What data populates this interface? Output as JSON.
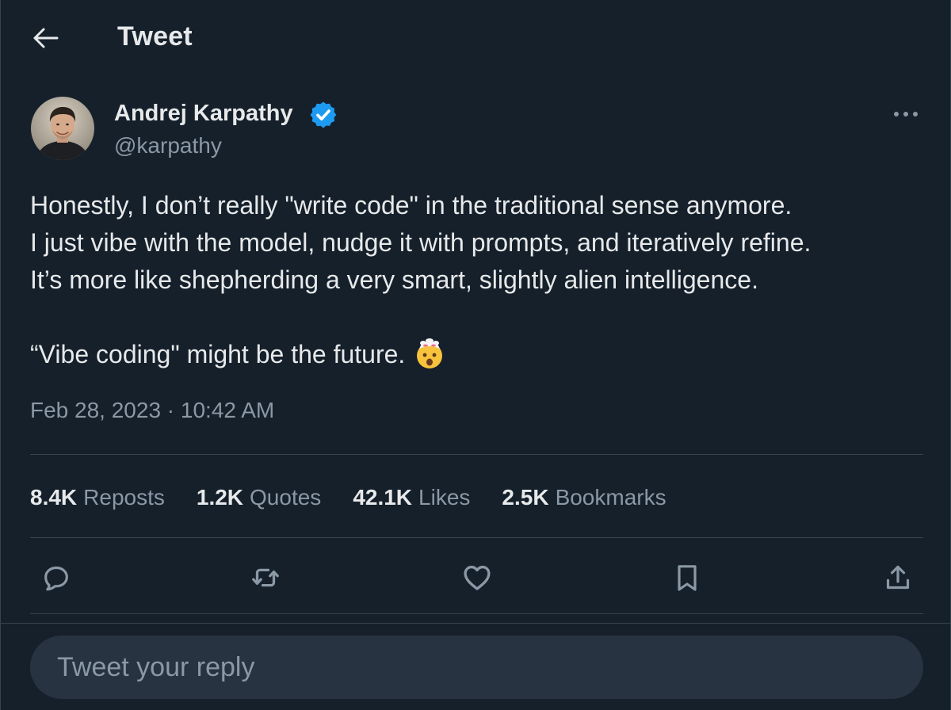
{
  "header": {
    "back_icon": "arrow-left-icon",
    "title": "Tweet"
  },
  "author": {
    "name": "Andrej Karpathy",
    "handle": "@karpathy",
    "verified_icon": "verified-badge-icon",
    "verified_color": "#1d9bf0",
    "more_icon": "more-horizontal-icon"
  },
  "tweet": {
    "lines": [
      "Honestly, I don’t really \"write code\" in the traditional sense anymore.",
      "I just vibe with the model, nudge it with prompts, and iteratively refine.",
      "It’s more like shepherding a very smart, slightly alien intelligence.",
      "“Vibe coding\" might be the future."
    ],
    "emoji": "exploding-head-emoji",
    "timestamp": "Feb 28, 2023 · 10:42 AM"
  },
  "stats": [
    {
      "value": "8.4K",
      "label": "Reposts"
    },
    {
      "value": "1.2K",
      "label": "Quotes"
    },
    {
      "value": "42.1K",
      "label": "Likes"
    },
    {
      "value": "2.5K",
      "label": "Bookmarks"
    }
  ],
  "actions": [
    {
      "icon": "reply-icon"
    },
    {
      "icon": "retweet-icon"
    },
    {
      "icon": "like-heart-icon"
    },
    {
      "icon": "bookmark-icon"
    },
    {
      "icon": "share-icon"
    }
  ],
  "reply": {
    "placeholder": "Tweet your reply"
  },
  "colors": {
    "background": "#15202b",
    "text_primary": "#e7e9ea",
    "text_secondary": "#8b98a5",
    "divider": "#38444d",
    "input_bg": "#273340"
  }
}
